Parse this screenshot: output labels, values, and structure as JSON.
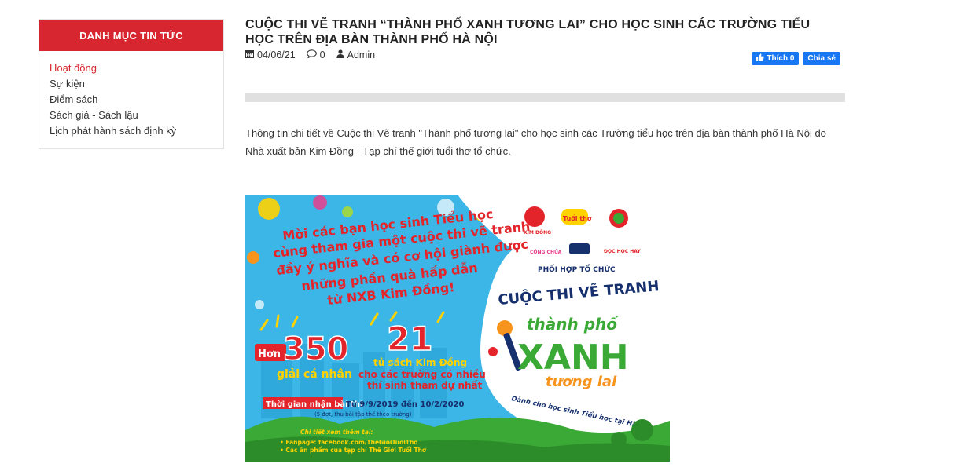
{
  "sidebar": {
    "heading": "DANH MỤC TIN TỨC",
    "items": [
      {
        "label": "Hoạt động",
        "active": true
      },
      {
        "label": "Sự kiện",
        "active": false
      },
      {
        "label": "Điểm sách",
        "active": false
      },
      {
        "label": "Sách giả - Sách lậu",
        "active": false
      },
      {
        "label": "Lịch phát hành sách định kỳ",
        "active": false
      }
    ]
  },
  "article": {
    "title": "CUỘC THI VẼ TRANH “THÀNH PHỐ XANH TƯƠNG LAI” CHO HỌC SINH CÁC TRƯỜNG TIỂU HỌC TRÊN ĐỊA BÀN THÀNH PHỐ HÀ NỘI",
    "date": "04/06/21",
    "comments": "0",
    "author": "Admin",
    "like_label": "Thích 0",
    "share_label": "Chia sẻ",
    "intro": "Thông tin chi tiết về Cuộc thi Vẽ tranh \"Thành phố tương lai\" cho học sinh các Trường tiểu học trên địa bàn thành phố Hà Nội do Nhà xuất bản Kim Đồng - Tạp chí thế giới tuổi thơ tổ chức."
  },
  "banner": {
    "invite_lines": [
      "Mời các bạn học sinh Tiểu học",
      "cùng tham gia một cuộc thi vẽ tranh",
      "đầy ý nghĩa và có cơ hội giành được",
      "những phần quà hấp dẫn",
      "từ NXB Kim Đồng!"
    ],
    "prize1_prefix": "Hơn",
    "prize1_number": "350",
    "prize1_label": "giải cá nhân",
    "prize2_number": "21",
    "prize2_label_lines": [
      "tủ sách Kim Đồng",
      "cho các trường có nhiều",
      "thí sinh tham dự nhất"
    ],
    "period_label": "Thời gian nhận bài thi",
    "period_text": "Từ 9/9/2019 đến 10/2/2020",
    "period_note": "(5 đợt, thu bài tập thể theo trường)",
    "details_heading": "Chi tiết xem thêm tại:",
    "details_lines": [
      "• Fanpage: facebook.com/TheGioiTuoiTho",
      "• Các ấn phẩm của tạp chí Thế Giới Tuổi Thơ"
    ],
    "logos": [
      "KIM ĐỒNG",
      "Tuổi thơ",
      "CÔNG CHÚA",
      "ĐỌC HỌC HAY"
    ],
    "organizers_label": "PHỐI HỢP TỔ CHỨC",
    "contest_title": "CUỘC THI VẼ TRANH",
    "theme_top": "thành phố",
    "theme_main": "XANH",
    "theme_bottom": "tương lai",
    "audience": "Dành cho học sinh Tiểu học tại Hà Nội",
    "colors": {
      "sky": "#3cb6e6",
      "red": "#e3242b",
      "green": "#3aa935",
      "yellow": "#ffd200",
      "navy": "#16306e"
    }
  }
}
